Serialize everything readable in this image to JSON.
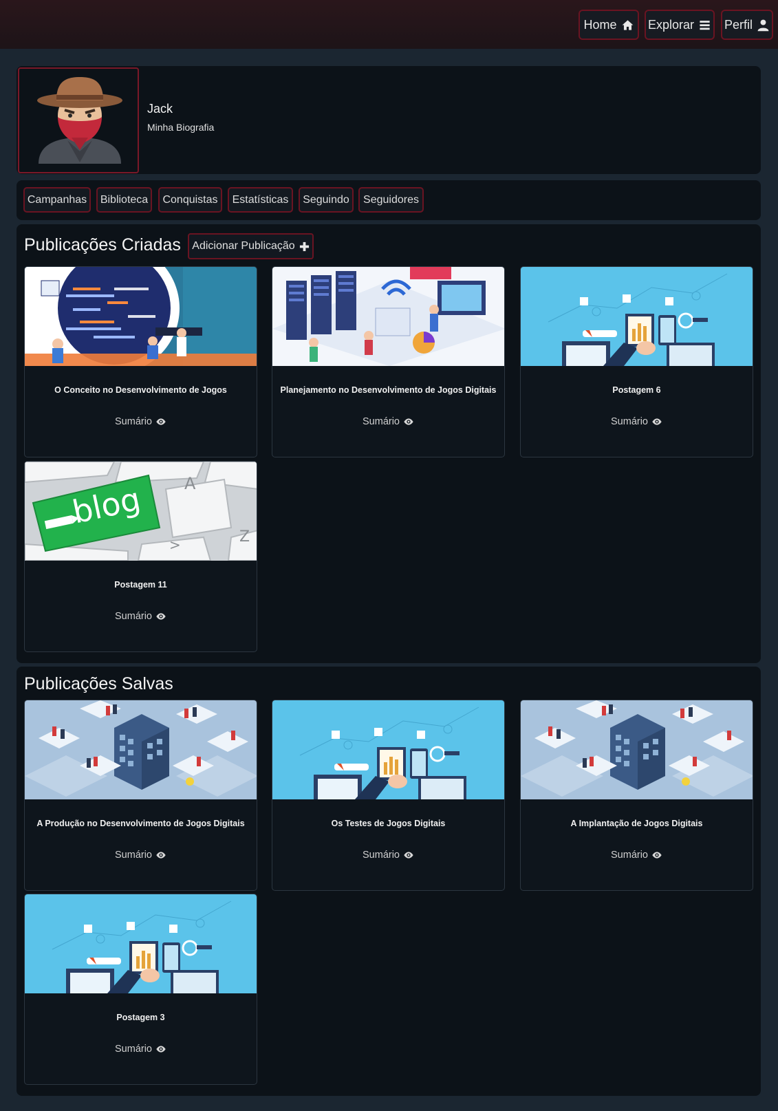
{
  "nav": {
    "home_label": "Home",
    "explore_label": "Explorar",
    "profile_label": "Perfil"
  },
  "profile": {
    "name": "Jack",
    "bio": "Minha Biografia"
  },
  "tabs": [
    {
      "label": "Campanhas"
    },
    {
      "label": "Biblioteca"
    },
    {
      "label": "Conquistas"
    },
    {
      "label": "Estatísticas"
    },
    {
      "label": "Seguindo"
    },
    {
      "label": "Seguidores"
    }
  ],
  "created": {
    "title": "Publicações Criadas",
    "add_label": "Adicionar Publicação",
    "cards": [
      {
        "title": "O Conceito no Desenvolvimento de Jogos",
        "link": "Sumário",
        "image": "developers-code-illustration"
      },
      {
        "title": "Planejamento no Desenvolvimento de Jogos Digitais",
        "link": "Sumário",
        "image": "data-center-illustration"
      },
      {
        "title": "Postagem 6",
        "link": "Sumário",
        "image": "analytics-devices-illustration"
      },
      {
        "title": "Postagem 11",
        "link": "Sumário",
        "image": "blog-keyboard-photo"
      }
    ]
  },
  "saved": {
    "title": "Publicações Salvas",
    "cards": [
      {
        "title": "A Produção no Desenvolvimento de Jogos Digitais",
        "link": "Sumário",
        "image": "isometric-office-illustration"
      },
      {
        "title": "Os Testes de Jogos Digitais",
        "link": "Sumário",
        "image": "analytics-devices-illustration"
      },
      {
        "title": "A Implantação de Jogos Digitais",
        "link": "Sumário",
        "image": "isometric-office-illustration"
      },
      {
        "title": "Postagem 3",
        "link": "Sumário",
        "image": "analytics-devices-illustration"
      }
    ]
  },
  "colors": {
    "accent_border": "#6a1422",
    "page_bg": "#1b2631",
    "panel_bg": "#0c1218"
  }
}
